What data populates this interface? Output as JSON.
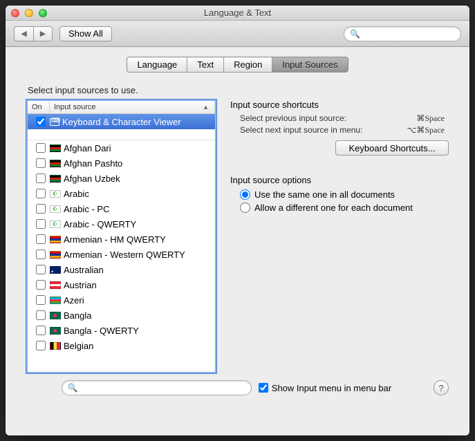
{
  "window": {
    "title": "Language & Text"
  },
  "toolbar": {
    "showAll": "Show All"
  },
  "tabs": {
    "language": "Language",
    "text": "Text",
    "region": "Region",
    "inputSources": "Input Sources"
  },
  "instruction": "Select input sources to use.",
  "listHeader": {
    "on": "On",
    "inputSource": "Input source"
  },
  "sources": [
    {
      "name": "Keyboard & Character Viewer",
      "checked": true,
      "selected": true,
      "flag": "kbd"
    },
    {
      "name": "Afghan Dari",
      "flag": "#000,#d32011,#007a36"
    },
    {
      "name": "Afghan Pashto",
      "flag": "#000,#d32011,#007a36"
    },
    {
      "name": "Afghan Uzbek",
      "flag": "#000,#d32011,#007a36"
    },
    {
      "name": "Arabic",
      "flag": "crescent"
    },
    {
      "name": "Arabic - PC",
      "flag": "crescent-pc"
    },
    {
      "name": "Arabic - QWERTY",
      "flag": "crescent"
    },
    {
      "name": "Armenian - HM QWERTY",
      "flag": "#d90012,#0033a0,#f2a800"
    },
    {
      "name": "Armenian - Western QWERTY",
      "flag": "#d90012,#0033a0,#f2a800"
    },
    {
      "name": "Australian",
      "flag": "ensign-blue"
    },
    {
      "name": "Austrian",
      "flag": "#ed2939,#fff,#ed2939"
    },
    {
      "name": "Azeri",
      "flag": "#00b5e2,#ef3340,#509e2f"
    },
    {
      "name": "Bangla",
      "flag": "bangla"
    },
    {
      "name": "Bangla - QWERTY",
      "flag": "bangla"
    },
    {
      "name": "Belgian",
      "flag": "v#000,#fae042,#ed2939"
    }
  ],
  "shortcuts": {
    "heading": "Input source shortcuts",
    "prev": {
      "label": "Select previous input source:",
      "key": "⌘Space"
    },
    "next": {
      "label": "Select next input source in menu:",
      "key": "⌥⌘Space"
    },
    "button": "Keyboard Shortcuts..."
  },
  "options": {
    "heading": "Input source options",
    "same": "Use the same one in all documents",
    "diff": "Allow a different one for each document"
  },
  "bottom": {
    "showMenu": "Show Input menu in menu bar"
  }
}
